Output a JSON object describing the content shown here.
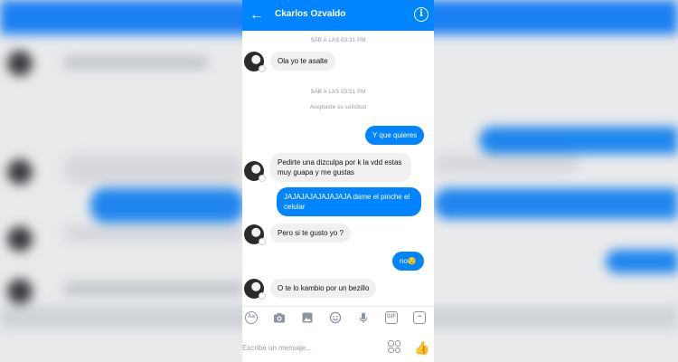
{
  "header": {
    "contact_name": "Ckarlos Ozvaldo",
    "back_icon": "back-arrow-icon",
    "info_icon": "info-icon",
    "info_glyph": "i",
    "back_glyph": "←"
  },
  "conversation": {
    "timestamp_1": "SÁB A LAS 03:31 PM",
    "timestamp_2": "SÁB A LAS 03:51 PM",
    "accepted_notice": "Aceptaste su solicitud",
    "messages": [
      {
        "sender": "contact",
        "text": "Ola yo te asalte"
      },
      {
        "sender": "me",
        "text": "Y que quieres"
      },
      {
        "sender": "contact",
        "text": "Pedirte una dizculpa por k la vdd estas muy guapa y me gustas"
      },
      {
        "sender": "me",
        "text": "JAJAJAJAJAJAJAJA dame el pinche el celular"
      },
      {
        "sender": "contact",
        "text": "Pero si te gusto yo ?"
      },
      {
        "sender": "me",
        "text": "no😒"
      },
      {
        "sender": "contact",
        "text": "O te lo kambio por un bezillo"
      }
    ]
  },
  "toolbar": {
    "icons": [
      "text-style-icon",
      "camera-icon",
      "gallery-icon",
      "emoji-icon",
      "microphone-icon",
      "gif-icon",
      "more-icon"
    ],
    "text_style_label": "Aa",
    "gif_label": "GIF",
    "more_label": "•••"
  },
  "composer": {
    "placeholder": "Escribe un mensaje...",
    "like_glyph": "👍"
  },
  "colors": {
    "brand_blue": "#0084ff",
    "incoming_bubble": "#f1f0f0",
    "timestamp_gray": "#90949c"
  }
}
